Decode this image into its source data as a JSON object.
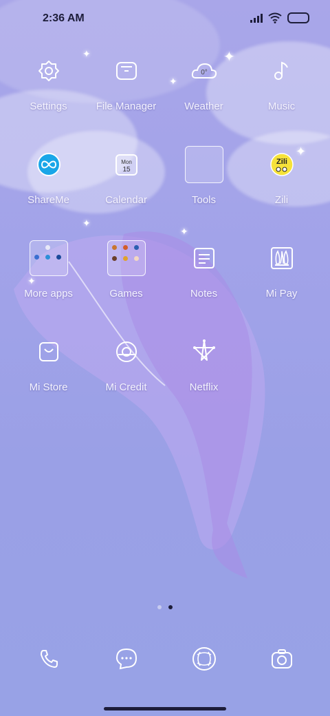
{
  "status_bar": {
    "time": "2:36 AM"
  },
  "apps": [
    {
      "label": "Settings",
      "icon": "gear-icon"
    },
    {
      "label": "File Manager",
      "icon": "folder-icon"
    },
    {
      "label": "Weather",
      "icon": "cloud-icon",
      "icon_text": "0°"
    },
    {
      "label": "Music",
      "icon": "music-note-icon"
    },
    {
      "label": "ShareMe",
      "icon": "infinity-icon"
    },
    {
      "label": "Calendar",
      "icon": "calendar-icon",
      "icon_day": "Mon",
      "icon_date": "15"
    },
    {
      "label": "Tools",
      "icon": "tools-folder-icon"
    },
    {
      "label": "Zili",
      "icon": "zili-logo",
      "icon_text": "Zili"
    },
    {
      "label": "More apps",
      "icon": "more-apps-folder-icon"
    },
    {
      "label": "Games",
      "icon": "games-folder-icon"
    },
    {
      "label": "Notes",
      "icon": "notes-icon"
    },
    {
      "label": "Mi Pay",
      "icon": "mi-pay-icon"
    },
    {
      "label": "Mi Store",
      "icon": "shopping-bag-icon"
    },
    {
      "label": "Mi Credit",
      "icon": "mi-credit-icon"
    },
    {
      "label": "Netflix",
      "icon": "star-icon"
    }
  ],
  "dock": [
    {
      "icon": "phone-icon"
    },
    {
      "icon": "messages-icon"
    },
    {
      "icon": "browser-icon"
    },
    {
      "icon": "camera-icon"
    }
  ],
  "pages": {
    "count": 2,
    "active": 2
  },
  "colors": {
    "background": "#a2a3e9",
    "dark_text": "#1d1d3a",
    "shareme_blue": "#1aa6e8",
    "zili_yellow": "#f6e23a"
  }
}
